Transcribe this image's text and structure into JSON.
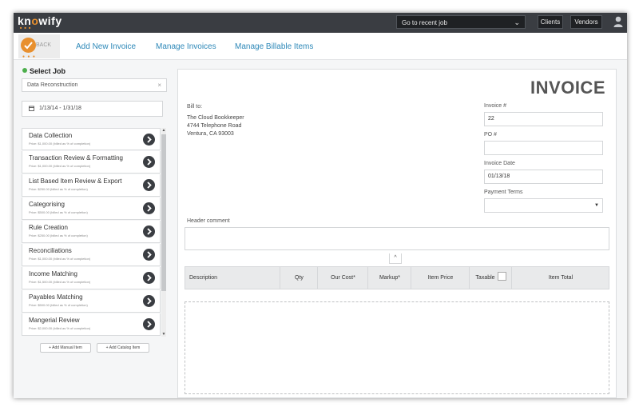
{
  "app": {
    "logo": "knowify",
    "logo_sub": "■ ■ ■"
  },
  "topbar": {
    "recent_job_placeholder": "Go to recent job",
    "clients_label": "Clients",
    "vendors_label": "Vendors"
  },
  "nav": {
    "back_label": "BACK",
    "links": [
      "Add New Invoice",
      "Manage Invoices",
      "Manage Billable Items"
    ]
  },
  "left": {
    "select_job_title": "Select Job",
    "job_value": "Data Reconstruction",
    "clear_glyph": "×",
    "date_range": "1/13/14 - 1/31/18",
    "items": [
      {
        "name": "Data Collection",
        "price": "Price: $1,000.00 (billed as % of completion)"
      },
      {
        "name": "Transaction Review & Formatting",
        "price": "Price: $1,000.00 (billed as % of completion)"
      },
      {
        "name": "List Based Item Review & Export",
        "price": "Price: $250.00 (billed as % of completion)"
      },
      {
        "name": "Categorising",
        "price": "Price: $500.00 (billed as % of completion)"
      },
      {
        "name": "Rule Creation",
        "price": "Price: $250.00 (billed as % of completion)"
      },
      {
        "name": "Reconciliations",
        "price": "Price: $1,000.00 (billed as % of completion)"
      },
      {
        "name": "Income Matching",
        "price": "Price: $1,500.00 (billed as % of completion)"
      },
      {
        "name": "Payables Matching",
        "price": "Price: $500.00 (billed as % of completion)"
      },
      {
        "name": "Mangerial Review",
        "price": "Price: $2,000.00 (billed as % of completion)"
      }
    ],
    "add_manual_label": "+ Add Manual Item",
    "add_catalog_label": "+ Add Catalog Item"
  },
  "invoice": {
    "title": "INVOICE",
    "bill_to_label": "Bill to:",
    "bill_to_lines": [
      "The Cloud Bookkeeper",
      "4744 Telephone Road",
      "Ventura, CA 93003"
    ],
    "invoice_no_label": "Invoice #",
    "invoice_no_value": "22",
    "po_label": "PO #",
    "po_value": "",
    "date_label": "Invoice Date",
    "date_value": "01/13/18",
    "terms_label": "Payment Terms",
    "terms_value": "",
    "header_comment_label": "Header comment",
    "collapse_glyph": "^",
    "columns": [
      "Description",
      "Qty",
      "Our Cost*",
      "Markup*",
      "Item Price",
      "Taxable",
      "Item Total"
    ]
  },
  "colors": {
    "topbar": "#3a3d42",
    "accent_orange": "#e8902f",
    "link_blue": "#2d88b8",
    "status_green": "#4cae4c"
  },
  "icons": [
    "user-icon",
    "chevron-down-icon",
    "back-check-icon",
    "calendar-icon",
    "arrow-right-icon",
    "chevron-up-icon",
    "close-icon"
  ]
}
